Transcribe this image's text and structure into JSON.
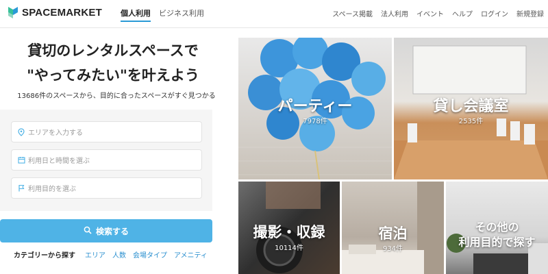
{
  "header": {
    "logo_text": "SPACEMARKET",
    "nav_left": {
      "personal": "個人利用",
      "business": "ビジネス利用"
    },
    "nav_right": [
      "スペース掲載",
      "法人利用",
      "イベント",
      "ヘルプ",
      "ログイン",
      "新規登録"
    ]
  },
  "hero": {
    "title_line1": "貸切のレンタルスペースで",
    "title_line2": "\"やってみたい\"を叶えよう",
    "subtitle": "13686件のスペースから、目的に合ったスペースがすぐ見つかる"
  },
  "search": {
    "area_placeholder": "エリアを入力する",
    "date_placeholder": "利用日と時間を選ぶ",
    "purpose_placeholder": "利用目的を選ぶ",
    "button_label": "検索する"
  },
  "categories": {
    "label": "カテゴリーから探す",
    "links": [
      "エリア",
      "人数",
      "会場タイプ",
      "アメニティ"
    ]
  },
  "tiles": {
    "party": {
      "title": "パーティー",
      "count": "7978件"
    },
    "meeting": {
      "title": "貸し会議室",
      "count": "2535件"
    },
    "photo": {
      "title": "撮影・収録",
      "count": "10114件"
    },
    "stay": {
      "title": "宿泊",
      "count": "934件"
    },
    "other": {
      "title_line1": "その他の",
      "title_line2": "利用目的で探す"
    }
  },
  "colors": {
    "accent": "#4fb3e6",
    "link": "#2a8fcf",
    "logo_green": "#37c19a",
    "logo_blue": "#2a9ad6"
  }
}
